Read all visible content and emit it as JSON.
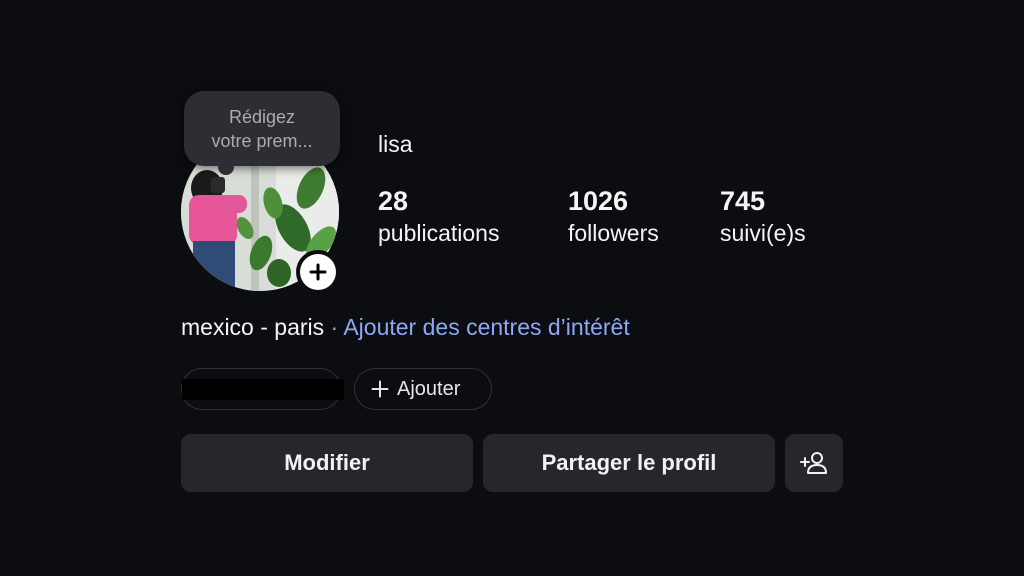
{
  "note": {
    "line1": "Rédigez",
    "line2": "votre prem..."
  },
  "profile": {
    "username": "lisa",
    "avatar_icon": "profile-photo",
    "add_story_icon": "plus-icon"
  },
  "stats": [
    {
      "value": "28",
      "label": "publications"
    },
    {
      "value": "1026",
      "label": "followers"
    },
    {
      "value": "745",
      "label": "suivi(e)s"
    }
  ],
  "bio": {
    "location": "mexico - paris",
    "separator": "·",
    "interests_link": "Ajouter des centres d’intérêt",
    "link_color": "#8fa8f5"
  },
  "pills": {
    "add_label": "Ajouter",
    "add_icon": "plus-icon"
  },
  "actions": {
    "edit_label": "Modifier",
    "share_label": "Partager le profil",
    "add_user_icon": "add-person-icon"
  }
}
